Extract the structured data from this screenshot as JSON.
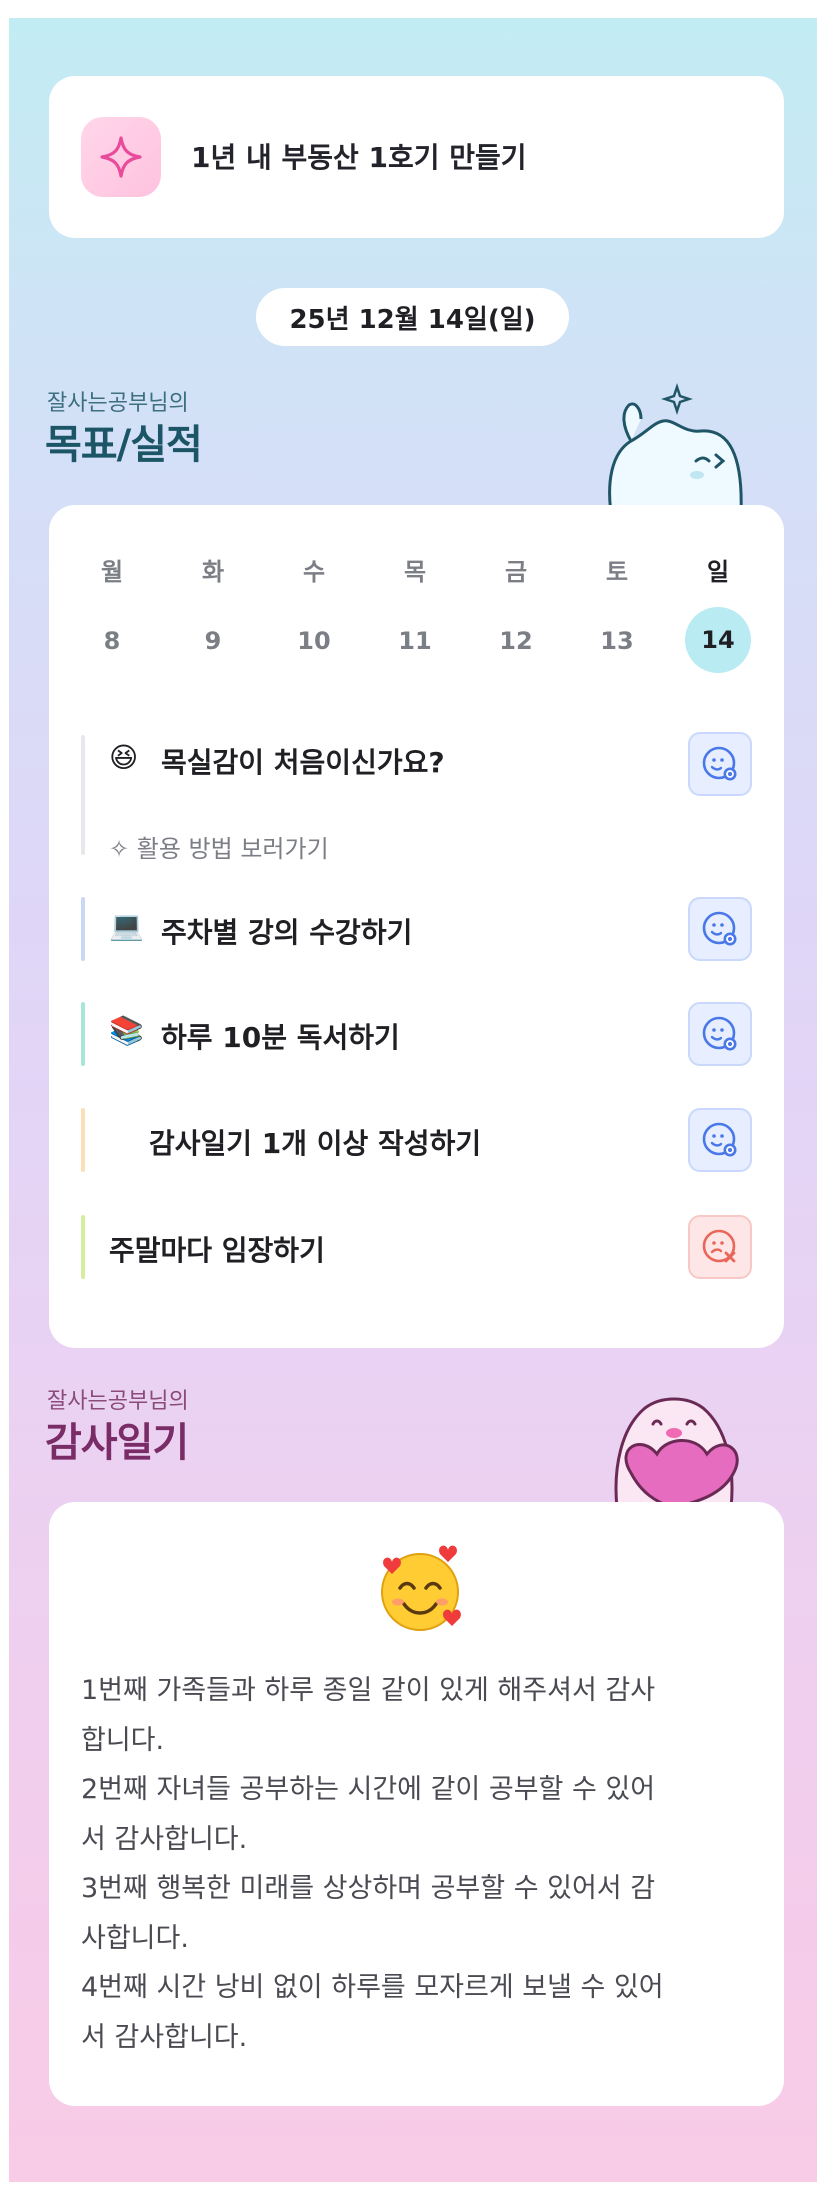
{
  "goal": {
    "text": "1년 내 부동산 1호기 만들기",
    "icon": "sparkle-icon"
  },
  "date": "25년 12월 14일(일)",
  "goals_section": {
    "subtitle": "잘사는공부님의",
    "title": "목표/실적"
  },
  "week": {
    "days": [
      {
        "name": "월",
        "num": "8",
        "today": false
      },
      {
        "name": "화",
        "num": "9",
        "today": false
      },
      {
        "name": "수",
        "num": "10",
        "today": false
      },
      {
        "name": "목",
        "num": "11",
        "today": false
      },
      {
        "name": "금",
        "num": "12",
        "today": false
      },
      {
        "name": "토",
        "num": "13",
        "today": false
      },
      {
        "name": "일",
        "num": "14",
        "today": true
      }
    ]
  },
  "tasks": [
    {
      "emoji": "😆",
      "label": "목실감이 처음이신가요?",
      "sub": "활용 방법 보러가기",
      "bar_color": "#e8e8ec",
      "status": "done"
    },
    {
      "emoji": "💻",
      "label": "주차별 강의 수강하기",
      "bar_color": "#c9d9f5",
      "status": "done"
    },
    {
      "emoji": "📚",
      "label": "하루 10분 독서하기",
      "bar_color": "#a9e6d9",
      "status": "done"
    },
    {
      "emoji": "",
      "label": "감사일기 1개 이상 작성하기",
      "bar_color": "#fbdfb9",
      "status": "done"
    },
    {
      "emoji": "",
      "label": "주말마다 임장하기",
      "bar_color": "#d6eda1",
      "status": "missed"
    }
  ],
  "gratitude_section": {
    "subtitle": "잘사는공부님의",
    "title": "감사일기"
  },
  "gratitude": {
    "emoji": "smiling-face-with-hearts",
    "lines": [
      "1번째 가족들과 하루 종일 같이 있게 해주셔서 감사",
      "합니다.",
      "2번째 자녀들 공부하는 시간에 같이 공부할 수 있어",
      "서 감사합니다.",
      "3번째 행복한 미래를 상상하며 공부할 수 있어서 감",
      "사합니다.",
      "4번째 시간 낭비 없이 하루를 모자르게 보낼 수 있어",
      "서 감사합니다."
    ]
  },
  "colors": {
    "today_highlight": "#b9ebf2",
    "done_button": "#4a78e8",
    "missed_button": "#e8675a"
  }
}
